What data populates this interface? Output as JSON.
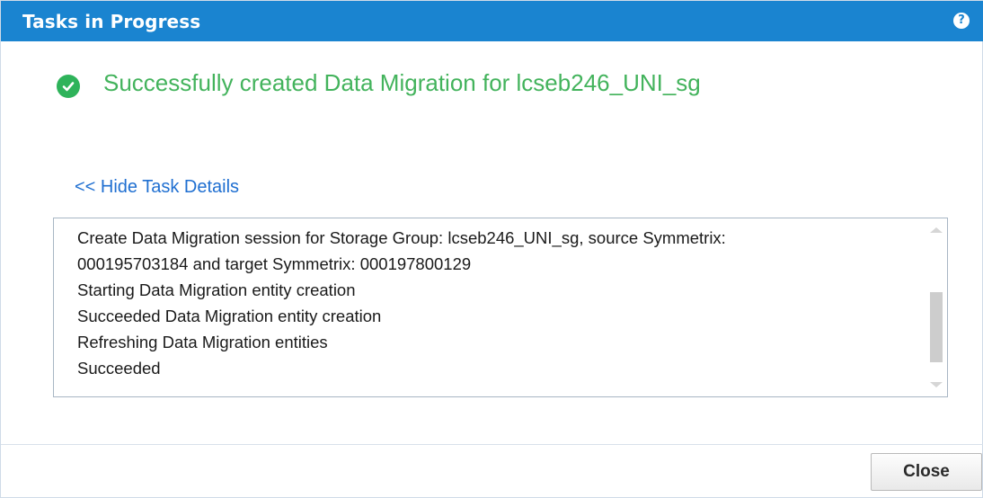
{
  "dialog": {
    "title": "Tasks in Progress",
    "help_icon_glyph": "?",
    "colors": {
      "titlebar": "#1a84d0",
      "success": "#43b35c",
      "link": "#1f6fd1"
    }
  },
  "status": {
    "icon": "check-circle-icon",
    "message": "Successfully created Data Migration for lcseb246_UNI_sg"
  },
  "details": {
    "toggle_label": "<< Hide Task Details",
    "log_lines": [
      "Create Data Migration session for Storage Group: lcseb246_UNI_sg, source Symmetrix:",
      "000195703184 and target Symmetrix: 000197800129",
      "Starting Data Migration entity creation",
      "Succeeded Data Migration entity creation",
      "Refreshing Data Migration entities",
      "Succeeded"
    ]
  },
  "footer": {
    "close_label": "Close"
  }
}
